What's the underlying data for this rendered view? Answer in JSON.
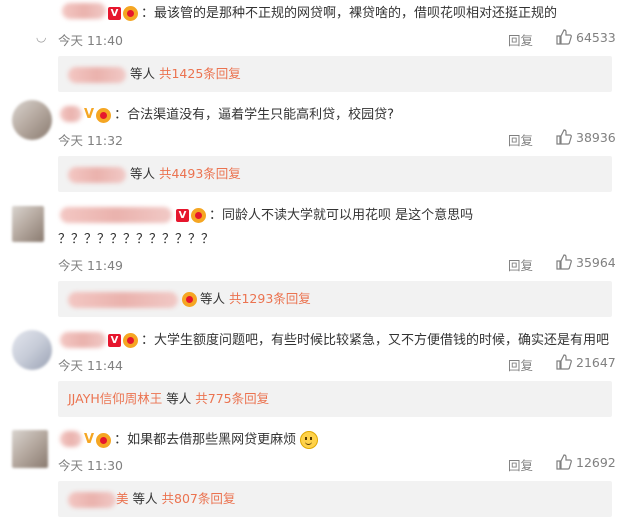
{
  "comments": [
    {
      "text": "：最该管的是那种不正规的网贷啊，裸贷啥的，借呗花呗相对还挺正规的",
      "time": "今天 11:40",
      "reply_label": "回复",
      "likes": "64533",
      "replies": {
        "etc": "等人",
        "count": "共1425条回复"
      }
    },
    {
      "text": "：合法渠道没有，逼着学生只能高利贷，校园贷?",
      "time": "今天 11:32",
      "reply_label": "回复",
      "likes": "38936",
      "replies": {
        "etc": "等人",
        "count": "共4493条回复"
      }
    },
    {
      "text": "：同龄人不读大学就可以用花呗 是这个意思吗",
      "text2": "？？？？？？？？？？？？",
      "time": "今天 11:49",
      "reply_label": "回复",
      "likes": "35964",
      "replies": {
        "etc": "等人",
        "count": "共1293条回复"
      }
    },
    {
      "text": "：大学生额度问题吧，有些时候比较紧急，又不方便借钱的时候，确实还是有用吧",
      "time": "今天 11:44",
      "reply_label": "回复",
      "likes": "21647",
      "replies": {
        "name": "JJAYH信仰周林王",
        "etc": "等人",
        "count": "共775条回复"
      }
    },
    {
      "text": "：如果都去借那些黑网贷更麻烦",
      "time": "今天 11:30",
      "reply_label": "回复",
      "likes": "12692",
      "replies": {
        "name_tail": "美",
        "etc": "等人",
        "count": "共807条回复"
      }
    }
  ],
  "icons": {
    "like": "thumbs-up-icon",
    "vip": "vip-badge-icon",
    "smile": "smile-emoji-icon"
  },
  "colors": {
    "link": "#eb7350",
    "meta": "#808080",
    "vip": "#e6162d"
  }
}
